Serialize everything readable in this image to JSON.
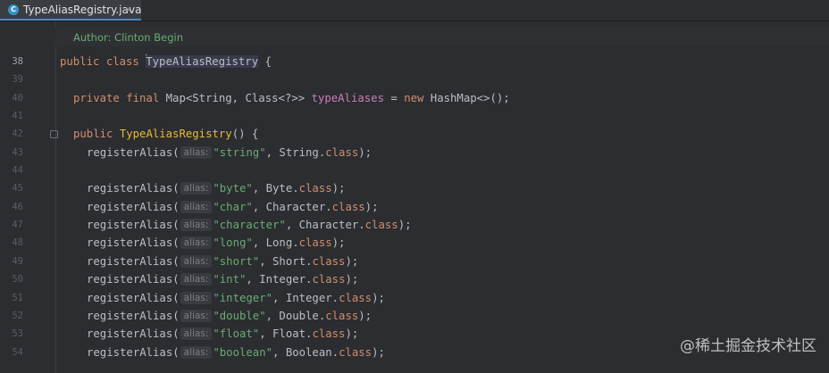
{
  "tab": {
    "label": "TypeAliasRegistry.java",
    "icon_letter": "C",
    "close": "×"
  },
  "doc": {
    "author": "Author: Clinton Begin"
  },
  "line_numbers": [
    "38",
    "39",
    "40",
    "41",
    "42",
    "43",
    "44",
    "45",
    "46",
    "47",
    "48",
    "49",
    "50",
    "51",
    "52",
    "53",
    "54"
  ],
  "code": {
    "l38": {
      "kw": "public class",
      "name": "TypeAliasRegistry",
      "brace": " {"
    },
    "l40": {
      "kw1": "private final",
      "type1": " Map<String, Class<?>> ",
      "field": "typeAliases",
      "eq": " = ",
      "kw2": "new",
      "rest": " HashMap<>();"
    },
    "l42": {
      "kw": "public",
      "name": "TypeAliasRegistry",
      "rest": "() {"
    },
    "hint_label": "alias:",
    "registrations": [
      {
        "call": "registerAlias(",
        "str": "\"string\"",
        "mid": ", String.",
        "kw": "class",
        "end": ");"
      },
      {
        "call": "registerAlias(",
        "str": "\"byte\"",
        "mid": ", Byte.",
        "kw": "class",
        "end": ");"
      },
      {
        "call": "registerAlias(",
        "str": "\"char\"",
        "mid": ", Character.",
        "kw": "class",
        "end": ");"
      },
      {
        "call": "registerAlias(",
        "str": "\"character\"",
        "mid": ", Character.",
        "kw": "class",
        "end": ");"
      },
      {
        "call": "registerAlias(",
        "str": "\"long\"",
        "mid": ", Long.",
        "kw": "class",
        "end": ");"
      },
      {
        "call": "registerAlias(",
        "str": "\"short\"",
        "mid": ", Short.",
        "kw": "class",
        "end": ");"
      },
      {
        "call": "registerAlias(",
        "str": "\"int\"",
        "mid": ", Integer.",
        "kw": "class",
        "end": ");"
      },
      {
        "call": "registerAlias(",
        "str": "\"integer\"",
        "mid": ", Integer.",
        "kw": "class",
        "end": ");"
      },
      {
        "call": "registerAlias(",
        "str": "\"double\"",
        "mid": ", Double.",
        "kw": "class",
        "end": ");"
      },
      {
        "call": "registerAlias(",
        "str": "\"float\"",
        "mid": ", Float.",
        "kw": "class",
        "end": ");"
      },
      {
        "call": "registerAlias(",
        "str": "\"boolean\"",
        "mid": ", Boolean.",
        "kw": "class",
        "end": ");"
      }
    ]
  },
  "watermark": "@稀土掘金技术社区",
  "colors": {
    "background": "#2b2d30",
    "keyword": "#cf8e6d",
    "string": "#6aab73",
    "field": "#c77dbb",
    "tab_accent": "#4a88c7"
  }
}
